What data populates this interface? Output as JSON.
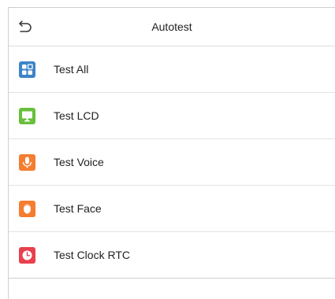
{
  "header": {
    "title": "Autotest",
    "back_icon": "back-arrow-icon"
  },
  "colors": {
    "test_all": "#3d84c8",
    "test_lcd": "#6abf3d",
    "test_voice": "#f47d30",
    "test_face": "#f47d30",
    "test_clock_rtc": "#e8404e"
  },
  "menu": {
    "items": [
      {
        "label": "Test All",
        "icon": "grid-icon"
      },
      {
        "label": "Test LCD",
        "icon": "monitor-icon"
      },
      {
        "label": "Test Voice",
        "icon": "microphone-icon"
      },
      {
        "label": "Test Face",
        "icon": "face-icon"
      },
      {
        "label": "Test Clock RTC",
        "icon": "clock-icon"
      }
    ]
  }
}
